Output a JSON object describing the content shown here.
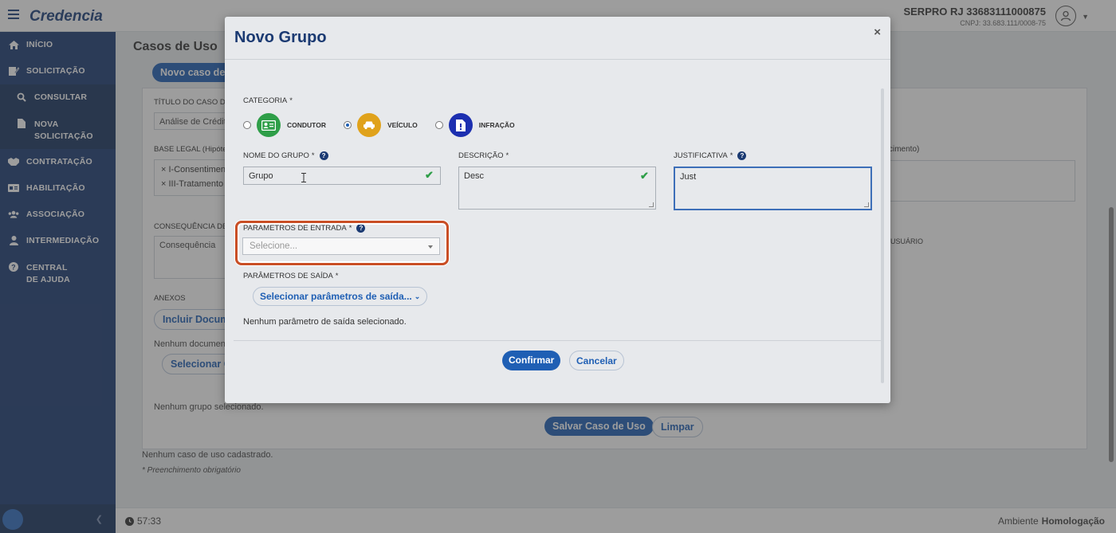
{
  "header": {
    "brand": "Credencia",
    "org_name": "SERPRO RJ 33683111000875",
    "org_cnpj": "CNPJ: 33.683.111/0008-75"
  },
  "sidebar": {
    "items": [
      {
        "label": "INÍCIO",
        "icon": "home-icon"
      },
      {
        "label": "SOLICITAÇÃO",
        "icon": "edit-document-icon"
      },
      {
        "label": "CONSULTAR",
        "icon": "search-icon"
      },
      {
        "label": "NOVA SOLICITAÇÃO",
        "icon": "file-icon"
      },
      {
        "label": "CONTRATAÇÃO",
        "icon": "handshake-icon"
      },
      {
        "label": "HABILITAÇÃO",
        "icon": "id-card-icon"
      },
      {
        "label": "ASSOCIAÇÃO",
        "icon": "users-icon"
      },
      {
        "label": "INTERMEDIAÇÃO",
        "icon": "user-tie-icon"
      },
      {
        "label": "CENTRAL DE AJUDA",
        "icon": "help-circle-icon"
      }
    ]
  },
  "status": {
    "timer": "57:33",
    "env_label": "Ambiente",
    "env_value": "Homologação"
  },
  "background": {
    "page_title": "Casos de Uso",
    "new_case_button": "Novo caso de u",
    "title_label": "TÍTULO DO CASO DE",
    "title_value": "Análise de Crédito",
    "base_legal_label": "BASE LEGAL (Hipóte",
    "base_legal_chips": [
      "× I-Consentimen",
      "× III-Tratamento"
    ],
    "right_label": "cimento)",
    "consequencia_label": "CONSEQUÊNCIA DE",
    "consequencia_value": "Consequência",
    "usuario_label": "USUÁRIO",
    "anexos_label": "ANEXOS",
    "incluir_button": "Incluir Docume",
    "nenhum_documento": "Nenhum document",
    "selecionar_button": "Selecionar G",
    "nenhum_grupo": "Nenhum grupo selecionado.",
    "salvar_button": "Salvar Caso de Uso",
    "limpar_button": "Limpar",
    "nenhum_caso": "Nenhum caso de uso cadastrado.",
    "obrigatorio": "* Preenchimento obrigatório"
  },
  "modal": {
    "title": "Novo Grupo",
    "close": "×",
    "categoria_label": "CATEGORIA",
    "categories": [
      {
        "label": "CONDUTOR",
        "checked": false,
        "color": "#2e9e48",
        "icon": "id-card-icon"
      },
      {
        "label": "VEÍCULO",
        "checked": true,
        "color": "#e0a21b",
        "icon": "car-icon"
      },
      {
        "label": "INFRAÇÃO",
        "checked": false,
        "color": "#1c2fb0",
        "icon": "document-alert-icon"
      }
    ],
    "nome_label": "NOME DO GRUPO",
    "nome_value": "Grupo",
    "descricao_label": "DESCRIÇÃO",
    "descricao_value": "Desc",
    "justificativa_label": "JUSTIFICATIVA",
    "justificativa_value": "Just",
    "entrada_label": "PARÂMETROS DE ENTRADA",
    "entrada_placeholder": "Selecione...",
    "saida_label": "PARÂMETROS DE SAÍDA",
    "saida_button": "Selecionar parâmetros de saída...",
    "saida_empty": "Nenhum parâmetro de saída selecionado.",
    "confirm_button": "Confirmar",
    "cancel_button": "Cancelar",
    "required_mark": "*"
  }
}
